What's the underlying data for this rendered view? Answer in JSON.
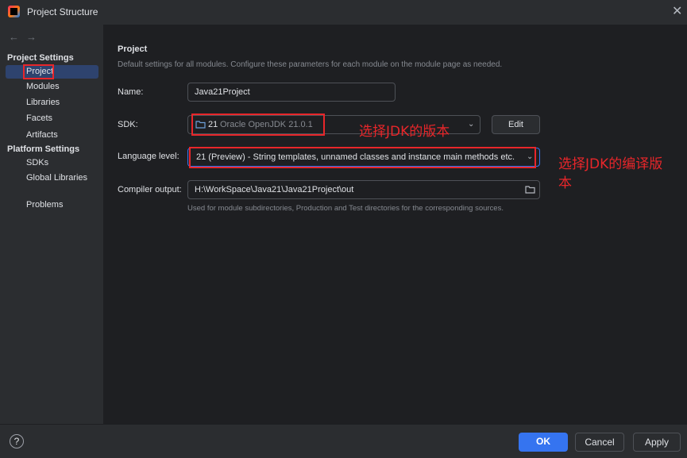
{
  "window": {
    "title": "Project Structure",
    "close_icon": "close-icon"
  },
  "sidebar": {
    "back_icon": "←",
    "forward_icon": "→",
    "section_project_settings": "Project Settings",
    "project_items": [
      "Project",
      "Modules",
      "Libraries",
      "Facets",
      "Artifacts"
    ],
    "section_platform_settings": "Platform Settings",
    "platform_items": [
      "SDKs",
      "Global Libraries"
    ],
    "problems": "Problems",
    "selected": "Project"
  },
  "main": {
    "title": "Project",
    "description": "Default settings for all modules. Configure these parameters for each module on the module page as needed.",
    "name_label": "Name:",
    "name_value": "Java21Project",
    "sdk_label": "SDK:",
    "sdk_version": "21",
    "sdk_name": "Oracle OpenJDK 21.0.1",
    "edit_label": "Edit",
    "language_label": "Language level:",
    "language_value": "21 (Preview) - String templates, unnamed classes and instance main methods etc.",
    "output_label": "Compiler output:",
    "output_value": "H:\\WorkSpace\\Java21\\Java21Project\\out",
    "output_hint": "Used for module subdirectories, Production and Test directories for the corresponding sources."
  },
  "annotations": {
    "sdk_note": "选择JDK的版本",
    "language_note_line1": "选择JDK的编译版",
    "language_note_line2": "本",
    "highlight_color": "#e8262a"
  },
  "footer": {
    "help": "?",
    "ok": "OK",
    "cancel": "Cancel",
    "apply": "Apply"
  },
  "colors": {
    "accent": "#3574f0",
    "selection": "#2e436e"
  }
}
